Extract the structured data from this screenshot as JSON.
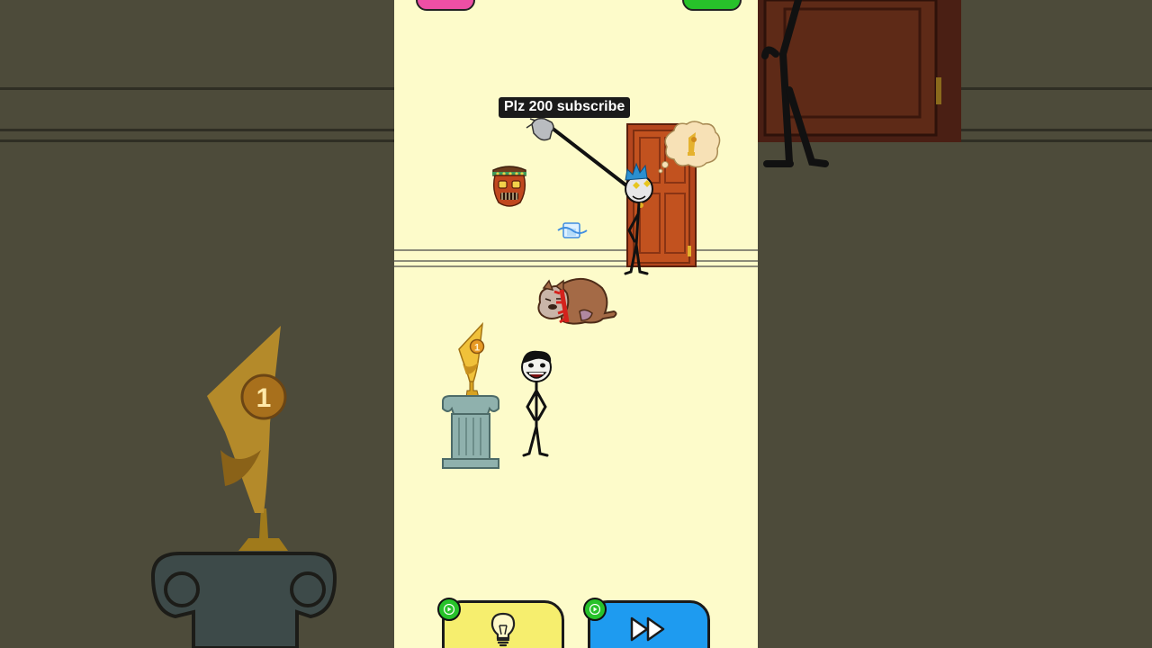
{
  "caption": {
    "text": "Plz 200 subscribe"
  },
  "trophy": {
    "rank_number": "1"
  },
  "buttons": {
    "hint_icon": "lightbulb-icon",
    "skip_icon": "fast-forward-icon",
    "ad_icon": "play-video-icon"
  },
  "colors": {
    "game_background": "#fdfbca",
    "side_background": "#4d4b3a",
    "hint_button": "#f6ee6e",
    "skip_button": "#1e9bf0",
    "ad_badge": "#27c22a",
    "door": "#b4461e"
  }
}
